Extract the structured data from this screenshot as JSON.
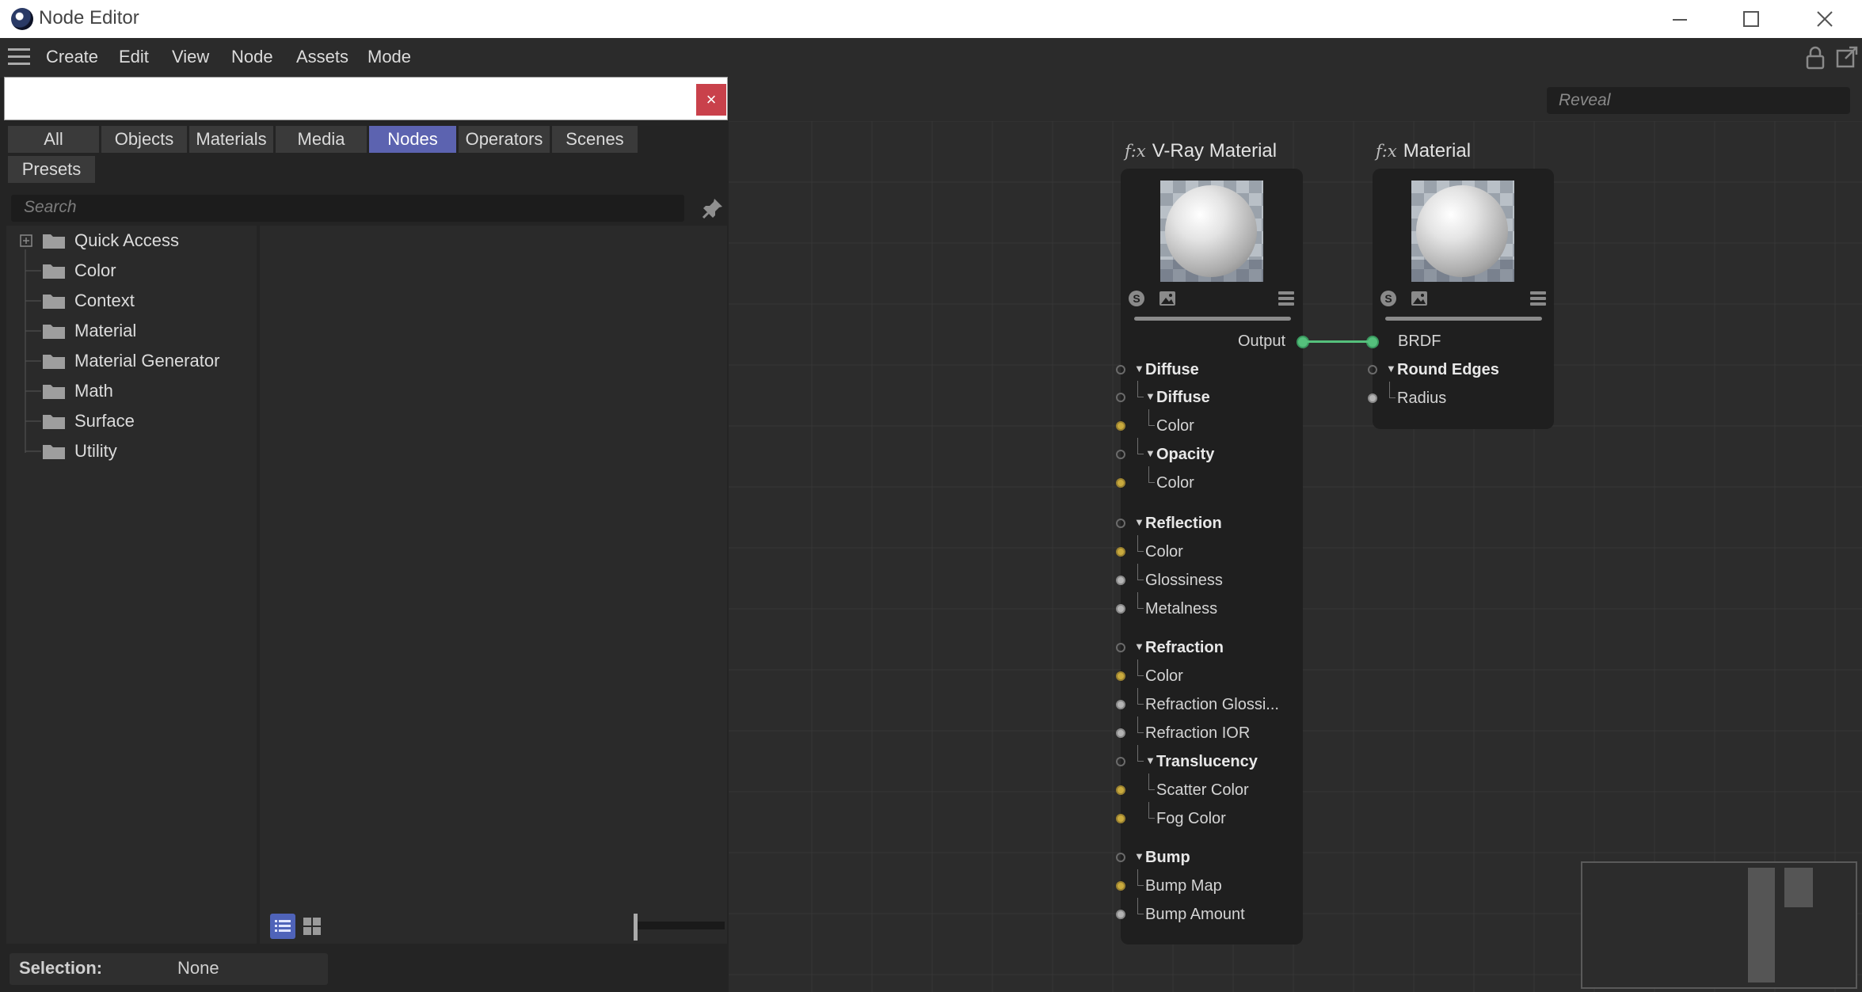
{
  "window": {
    "title": "Node Editor",
    "minimize": "—",
    "maximize": "☐",
    "close": "✕"
  },
  "menu": {
    "items": [
      "Create",
      "Edit",
      "View",
      "Node",
      "Assets",
      "Mode"
    ]
  },
  "reveal": {
    "placeholder": "Reveal"
  },
  "browser": {
    "close_label": "×",
    "tabs": [
      "All",
      "Objects",
      "Materials",
      "Media",
      "Nodes",
      "Operators",
      "Scenes",
      "Presets"
    ],
    "active_tab": "Nodes",
    "search_placeholder": "Search",
    "tree": [
      "Quick Access",
      "Color",
      "Context",
      "Material",
      "Material Generator",
      "Math",
      "Surface",
      "Utility"
    ],
    "selection_label": "Selection:",
    "selection_value": "None"
  },
  "nodes": {
    "vray": {
      "fx": "f:x",
      "title": "V-Ray Material",
      "output": "Output",
      "ports": [
        {
          "label": "Diffuse",
          "bold": true,
          "level": 0,
          "port": "empty",
          "expand": true
        },
        {
          "label": "Diffuse",
          "bold": true,
          "level": 1,
          "port": "empty",
          "expand": true
        },
        {
          "label": "Color",
          "bold": false,
          "level": 2,
          "port": "yellow"
        },
        {
          "label": "Opacity",
          "bold": true,
          "level": 1,
          "port": "empty",
          "expand": true
        },
        {
          "label": "Color",
          "bold": false,
          "level": 2,
          "port": "yellow"
        },
        {
          "label": "Reflection",
          "bold": true,
          "level": 0,
          "port": "empty",
          "expand": true
        },
        {
          "label": "Color",
          "bold": false,
          "level": 1,
          "port": "yellow"
        },
        {
          "label": "Glossiness",
          "bold": false,
          "level": 1,
          "port": "grey"
        },
        {
          "label": "Metalness",
          "bold": false,
          "level": 1,
          "port": "grey"
        },
        {
          "label": "Refraction",
          "bold": true,
          "level": 0,
          "port": "empty",
          "expand": true
        },
        {
          "label": "Color",
          "bold": false,
          "level": 1,
          "port": "yellow"
        },
        {
          "label": "Refraction Glossi...",
          "bold": false,
          "level": 1,
          "port": "grey"
        },
        {
          "label": "Refraction IOR",
          "bold": false,
          "level": 1,
          "port": "grey"
        },
        {
          "label": "Translucency",
          "bold": true,
          "level": 1,
          "port": "empty",
          "expand": true
        },
        {
          "label": "Scatter Color",
          "bold": false,
          "level": 2,
          "port": "yellow"
        },
        {
          "label": "Fog Color",
          "bold": false,
          "level": 2,
          "port": "yellow"
        },
        {
          "label": "Bump",
          "bold": true,
          "level": 0,
          "port": "empty",
          "expand": true
        },
        {
          "label": "Bump Map",
          "bold": false,
          "level": 1,
          "port": "yellow"
        },
        {
          "label": "Bump Amount",
          "bold": false,
          "level": 1,
          "port": "grey"
        }
      ]
    },
    "material": {
      "fx": "f:x",
      "title": "Material",
      "input": "BRDF",
      "ports": [
        {
          "label": "Round Edges",
          "bold": true,
          "level": 0,
          "port": "empty",
          "expand": true
        },
        {
          "label": "Radius",
          "bold": false,
          "level": 1,
          "port": "grey"
        }
      ]
    }
  },
  "colors": {
    "accent_tab": "#5c63b0",
    "link": "#55c07c",
    "color_port": "#c9aa3e",
    "close_button": "#c9414b"
  }
}
